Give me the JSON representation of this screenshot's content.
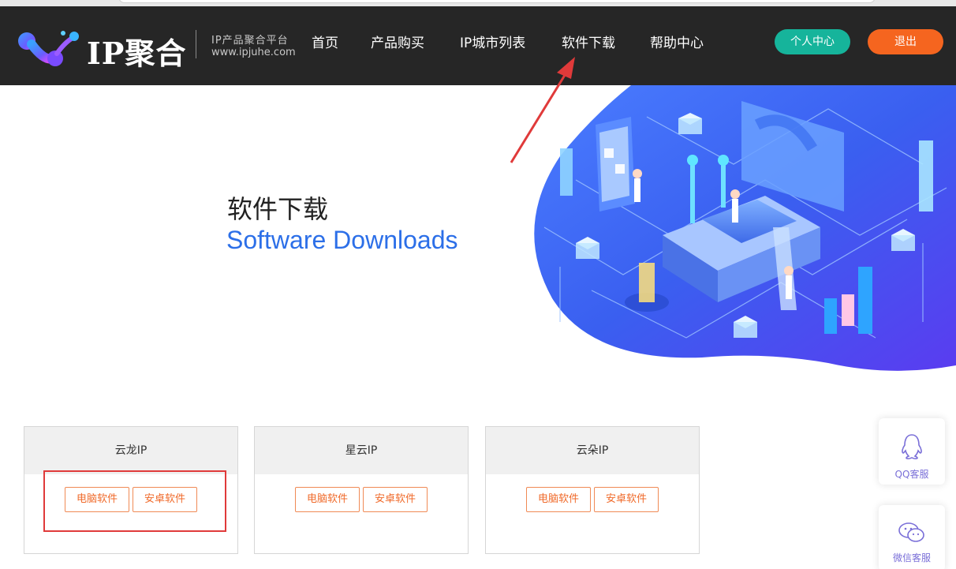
{
  "header": {
    "logo_text": "IP聚合",
    "logo_sub_cn": "IP产品聚合平台",
    "logo_sub_url": "www.ipjuhe.com",
    "nav": [
      {
        "label": "首页"
      },
      {
        "label": "产品购买"
      },
      {
        "label": "IP城市列表"
      },
      {
        "label": "软件下载"
      },
      {
        "label": "帮助中心"
      }
    ],
    "user_center_label": "个人中心",
    "logout_label": "退出"
  },
  "banner": {
    "title_cn": "软件下载",
    "title_en": "Software Downloads"
  },
  "cards": [
    {
      "name": "云龙IP",
      "pc_label": "电脑软件",
      "android_label": "安卓软件"
    },
    {
      "name": "星云IP",
      "pc_label": "电脑软件",
      "android_label": "安卓软件"
    },
    {
      "name": "云朵IP",
      "pc_label": "电脑软件",
      "android_label": "安卓软件"
    }
  ],
  "float": {
    "qq_label": "QQ客服",
    "wechat_label": "微信客服"
  },
  "colors": {
    "header_bg": "#262626",
    "accent_blue": "#2c6fe8",
    "user_btn": "#16b49b",
    "logout_btn": "#f5651f",
    "download_btn_text": "#f06a2a",
    "annotation_red": "#e03a3a"
  },
  "icons": {
    "logo": "molecule-logo-icon",
    "qq": "qq-penguin-icon",
    "wechat": "wechat-bubbles-icon"
  }
}
